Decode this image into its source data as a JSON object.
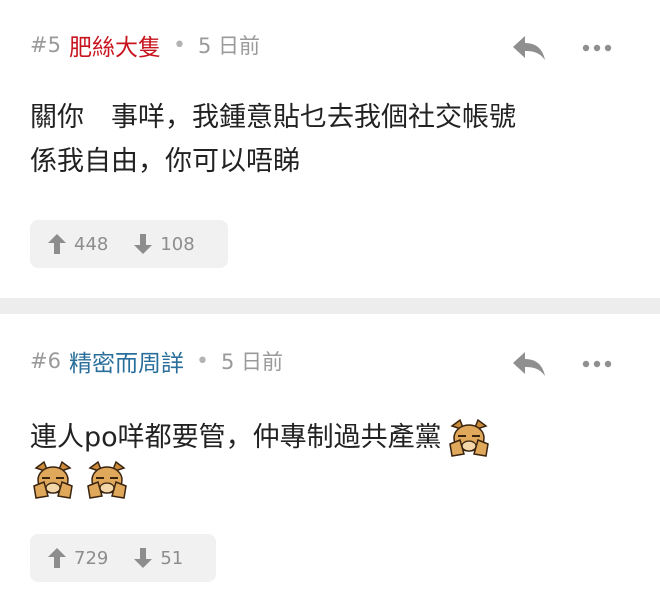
{
  "posts": [
    {
      "number": "#5",
      "username": "肥絲大隻",
      "username_color": "#c8141e",
      "separator": "•",
      "time": "5 日前",
      "body_lines": [
        "關你　事咩，我鍾意貼乜去我個社交帳號",
        "係我自由，你可以唔睇"
      ],
      "upvotes": "448",
      "downvotes": "108"
    },
    {
      "number": "#6",
      "username": "精密而周詳",
      "username_color": "#2a6f9b",
      "separator": "•",
      "time": "5 日前",
      "body_lines": [
        "連人po咩都要管，仲專制過共產黨"
      ],
      "emoji_icons": [
        "facepalm-dog-icon",
        "facepalm-dog-icon",
        "facepalm-dog-icon"
      ],
      "upvotes": "729",
      "downvotes": "51"
    }
  ],
  "icons": {
    "reply": "reply-arrow-icon",
    "more": "more-dots-icon",
    "upvote": "arrow-up-icon",
    "downvote": "arrow-down-icon"
  },
  "colors": {
    "meta_gray": "#9a9a9a",
    "text": "#222222",
    "vote_bg": "#f1f1f1",
    "separator_bg": "#ededed"
  }
}
